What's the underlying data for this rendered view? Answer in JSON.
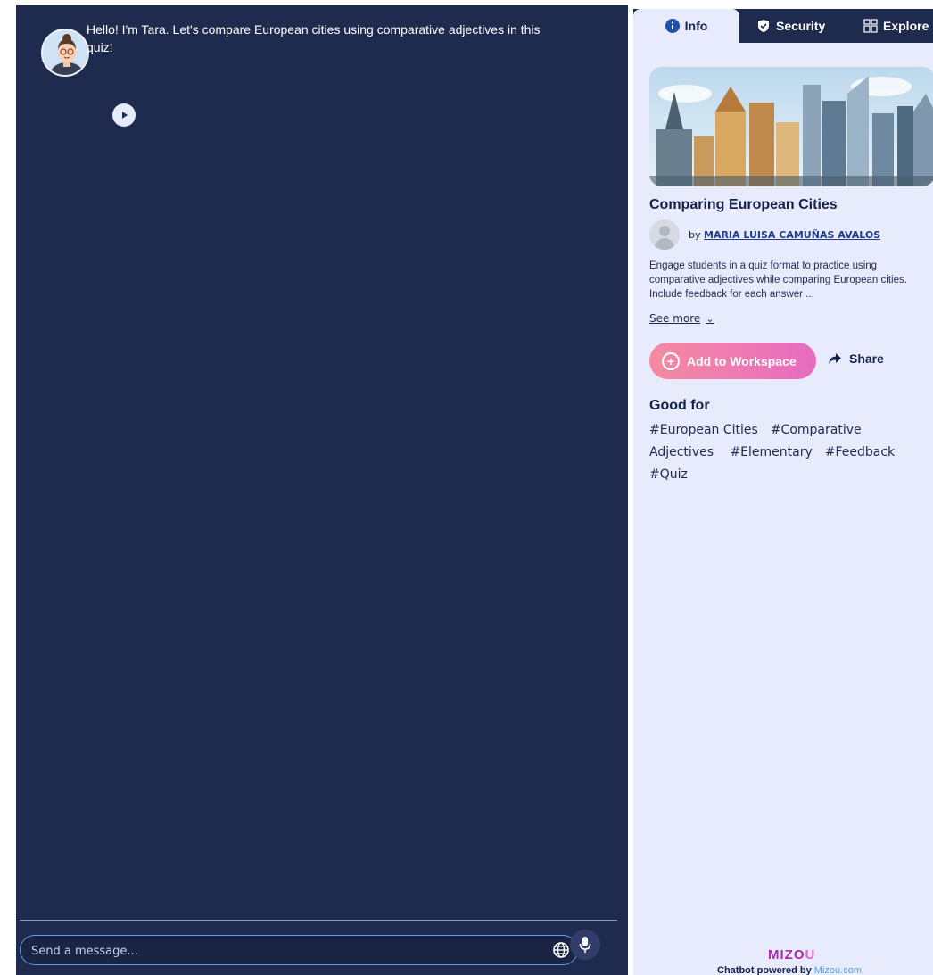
{
  "chat": {
    "assistant_name": "Tara",
    "message": "Hello! I'm Tara. Let's compare European cities using comparative adjectives in this quiz!",
    "input_placeholder": "Send a message..."
  },
  "tabs": [
    {
      "label": "Info",
      "icon": "info-icon",
      "active": true
    },
    {
      "label": "Security",
      "icon": "shield-icon",
      "active": false
    },
    {
      "label": "Explore",
      "icon": "grid-icon",
      "active": false
    }
  ],
  "info": {
    "title": "Comparing European Cities",
    "by": "by",
    "author": "MARIA LUISA CAMUÑAS AVALOS",
    "description": "Engage students in a quiz format to practice using comparative adjectives while comparing European cities. Include feedback for each answer ...",
    "see_more": "See more",
    "add_button": "Add to Workspace",
    "share": "Share",
    "good_for_heading": "Good for",
    "tags": [
      "#European Cities",
      "#Comparative Adjectives",
      "#Elementary",
      "#Feedback",
      "#Quiz"
    ]
  },
  "footer": {
    "brand_main": "MIZO",
    "brand_end": "U",
    "powered_text": "Chatbot powered by",
    "powered_link": "Mizou.com"
  },
  "colors": {
    "chat_bg": "#1f2a4f",
    "side_bg": "#e8ebfc",
    "accent_gradient_start": "#f48ba1",
    "accent_gradient_end": "#e86bc0"
  }
}
